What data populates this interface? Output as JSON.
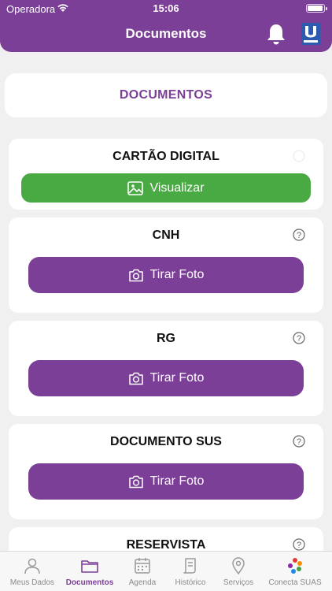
{
  "status": {
    "carrier": "Operadora",
    "time": "15:06"
  },
  "header": {
    "title": "Documentos"
  },
  "section": {
    "title": "DOCUMENTOS"
  },
  "cards": [
    {
      "title": "CARTÃO DIGITAL",
      "action": "Visualizar"
    },
    {
      "title": "CNH",
      "action": "Tirar Foto"
    },
    {
      "title": "RG",
      "action": "Tirar Foto"
    },
    {
      "title": "DOCUMENTO SUS",
      "action": "Tirar Foto"
    },
    {
      "title": "RESERVISTA"
    }
  ],
  "tabs": [
    "Meus Dados",
    "Documentos",
    "Agenda",
    "Histórico",
    "Serviços",
    "Conecta SUAS"
  ],
  "active_tab": "Documentos",
  "colors": {
    "brand": "#7b3f97",
    "success": "#49a942"
  }
}
